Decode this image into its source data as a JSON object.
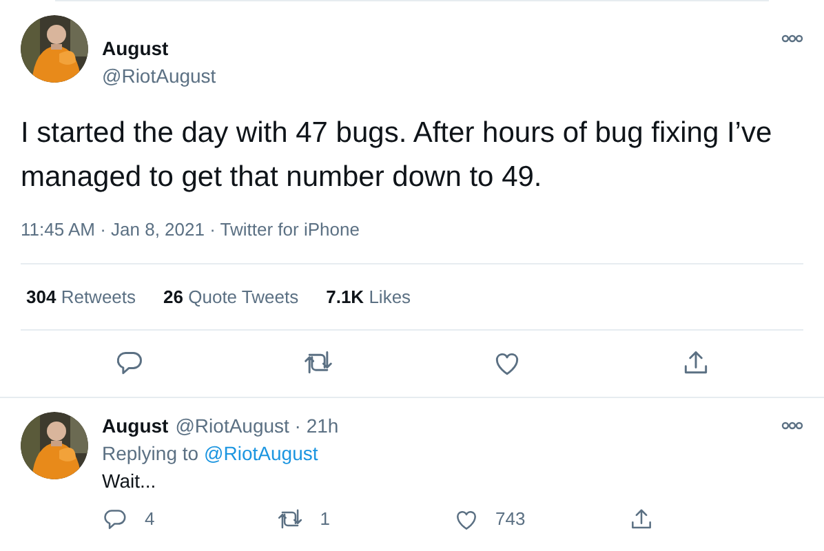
{
  "tweet": {
    "author": {
      "name": "August",
      "handle": "@RiotAugust"
    },
    "text": "I started the day with 47 bugs. After hours of bug fixing I’ve managed to get that number down to 49.",
    "meta": "11:45 AM · Jan 8, 2021 · Twitter for iPhone",
    "stats": [
      {
        "count": "304",
        "label": "Retweets"
      },
      {
        "count": "26",
        "label": "Quote Tweets"
      },
      {
        "count": "7.1K",
        "label": "Likes"
      }
    ],
    "actions": [
      {
        "kind": "reply"
      },
      {
        "kind": "retweet"
      },
      {
        "kind": "like"
      },
      {
        "kind": "share"
      }
    ]
  },
  "reply": {
    "author": {
      "name": "August",
      "handle": "@RiotAugust · 21h"
    },
    "replying_to": {
      "prefix": "Replying to",
      "handle": "@RiotAugust"
    },
    "text": "Wait...",
    "actions": [
      {
        "kind": "reply",
        "count": "4"
      },
      {
        "kind": "retweet",
        "count": "1"
      },
      {
        "kind": "like",
        "count": "743"
      },
      {
        "kind": "share"
      }
    ]
  }
}
